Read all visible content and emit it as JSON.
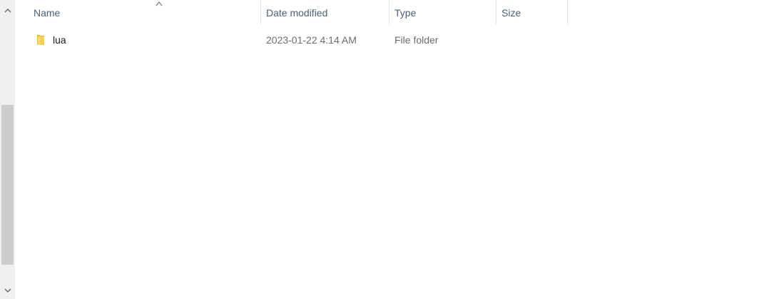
{
  "header": {
    "columns": [
      {
        "label": "Name"
      },
      {
        "label": "Date modified"
      },
      {
        "label": "Type"
      },
      {
        "label": "Size"
      }
    ]
  },
  "files": [
    {
      "name": "lua",
      "date_modified": "2023-01-22 4:14 AM",
      "type": "File folder",
      "size": "",
      "icon": "folder-icon"
    }
  ],
  "scrollbar": {
    "up_icon": "chevron-up-icon",
    "down_icon": "chevron-down-icon"
  },
  "colors": {
    "header_text": "#4c607a",
    "folder_yellow": "#f3c84b"
  }
}
